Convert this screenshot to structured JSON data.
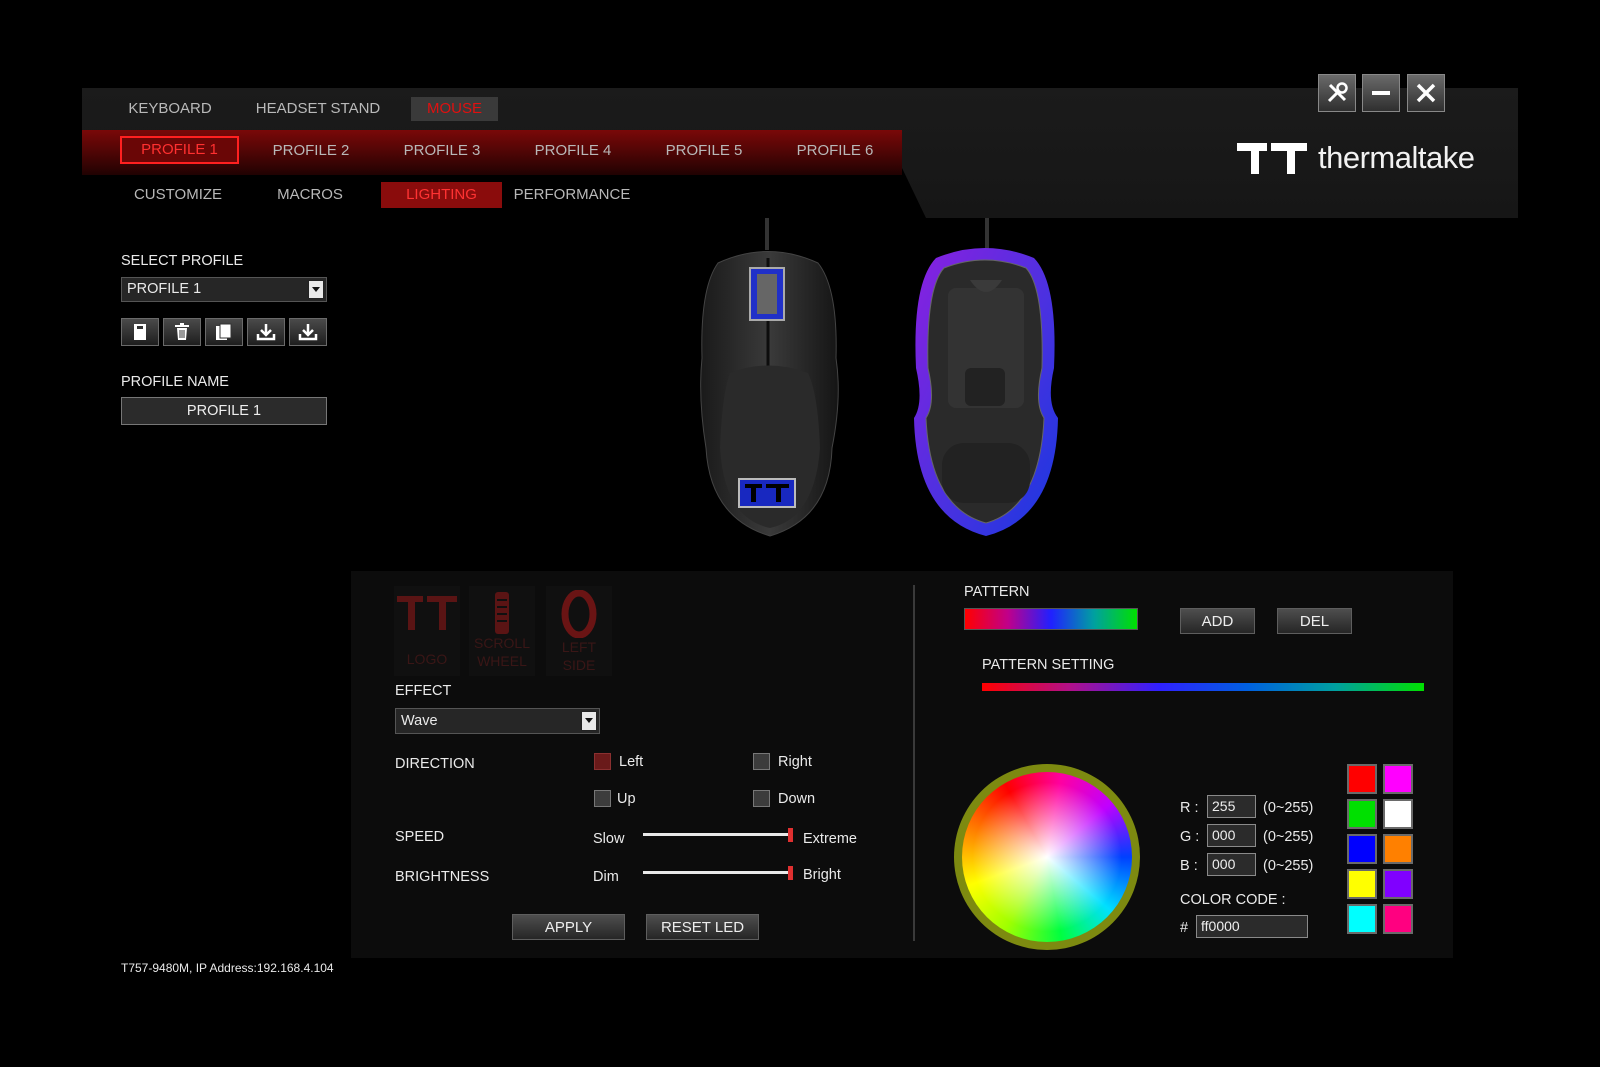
{
  "top_tabs": [
    {
      "label": "KEYBOARD"
    },
    {
      "label": "HEADSET STAND"
    },
    {
      "label": "MOUSE"
    }
  ],
  "profile_tabs": [
    {
      "label": "PROFILE 1"
    },
    {
      "label": "PROFILE 2"
    },
    {
      "label": "PROFILE 3"
    },
    {
      "label": "PROFILE 4"
    },
    {
      "label": "PROFILE 5"
    },
    {
      "label": "PROFILE 6"
    }
  ],
  "sub_tabs": [
    {
      "label": "CUSTOMIZE"
    },
    {
      "label": "MACROS"
    },
    {
      "label": "LIGHTING"
    },
    {
      "label": "PERFORMANCE"
    }
  ],
  "brand": {
    "name": "thermaltake",
    "logo_icon": "tt-logo-icon"
  },
  "window_buttons": [
    "tools-icon",
    "minimize-icon",
    "close-icon"
  ],
  "sidebar": {
    "select_profile_label": "SELECT PROFILE",
    "selected_profile": "PROFILE 1",
    "profile_actions": [
      "save-icon",
      "delete-icon",
      "copy-icon",
      "import-icon",
      "export-icon"
    ],
    "profile_name_label": "PROFILE NAME",
    "profile_name_value": "PROFILE 1"
  },
  "zones": [
    {
      "line1": "",
      "line2": "LOGO"
    },
    {
      "line1": "SCROLL",
      "line2": "WHEEL"
    },
    {
      "line1": "LEFT",
      "line2": "SIDE"
    }
  ],
  "lighting": {
    "effect_label": "EFFECT",
    "effect_value": "Wave",
    "direction_label": "DIRECTION",
    "directions": [
      {
        "label": "Left",
        "checked": true
      },
      {
        "label": "Right",
        "checked": false
      },
      {
        "label": "Up",
        "checked": false
      },
      {
        "label": "Down",
        "checked": false
      }
    ],
    "speed_label": "SPEED",
    "speed_min": "Slow",
    "speed_max": "Extreme",
    "speed_level": 1.0,
    "brightness_label": "BRIGHTNESS",
    "brightness_min": "Dim",
    "brightness_max": "Bright",
    "brightness_level": 1.0,
    "apply_label": "APPLY",
    "reset_label": "RESET LED"
  },
  "pattern": {
    "pattern_label": "PATTERN",
    "add_label": "ADD",
    "del_label": "DEL",
    "setting_label": "PATTERN SETTING"
  },
  "color": {
    "r_label": "R :",
    "g_label": "G :",
    "b_label": "B :",
    "r_value": "255",
    "g_value": "000",
    "b_value": "000",
    "range_hint": "(0~255)",
    "code_label": "COLOR CODE :",
    "hash": "#",
    "code_value": "ff0000",
    "swatches": [
      "#ff0000",
      "#ff00ff",
      "#00e000",
      "#ffffff",
      "#0000ff",
      "#ff8000",
      "#ffff00",
      "#8000ff",
      "#00ffff",
      "#ff0080"
    ]
  },
  "status": "T757-9480M, IP Address:192.168.4.104"
}
